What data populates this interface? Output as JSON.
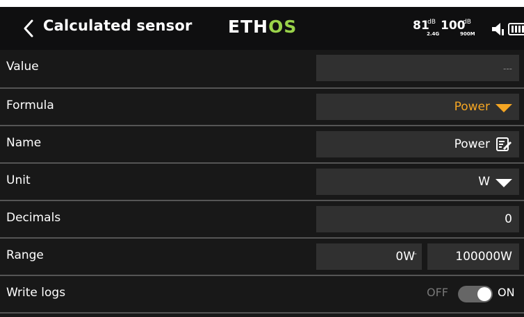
{
  "header": {
    "title": "Calculated sensor",
    "logo_left": "ETH",
    "logo_right": "OS",
    "rssi1": "81",
    "rssi1_unit": "dB",
    "rssi1_band": "2.4G",
    "rssi2": "100",
    "rssi2_unit": "dB",
    "rssi2_band": "900M"
  },
  "rows": {
    "value": {
      "label": "Value",
      "value": "---"
    },
    "formula": {
      "label": "Formula",
      "value": "Power"
    },
    "name": {
      "label": "Name",
      "value": "Power"
    },
    "unit": {
      "label": "Unit",
      "value": "W"
    },
    "decimals": {
      "label": "Decimals",
      "value": "0"
    },
    "range": {
      "label": "Range",
      "min": "0W",
      "sep": "-",
      "max": "100000W"
    },
    "write_logs": {
      "label": "Write logs",
      "off": "OFF",
      "on": "ON",
      "state": "on"
    }
  },
  "colors": {
    "accent": "#f5a623",
    "logo_os": "#9ad34a",
    "background": "#181818",
    "field": "#303030"
  }
}
